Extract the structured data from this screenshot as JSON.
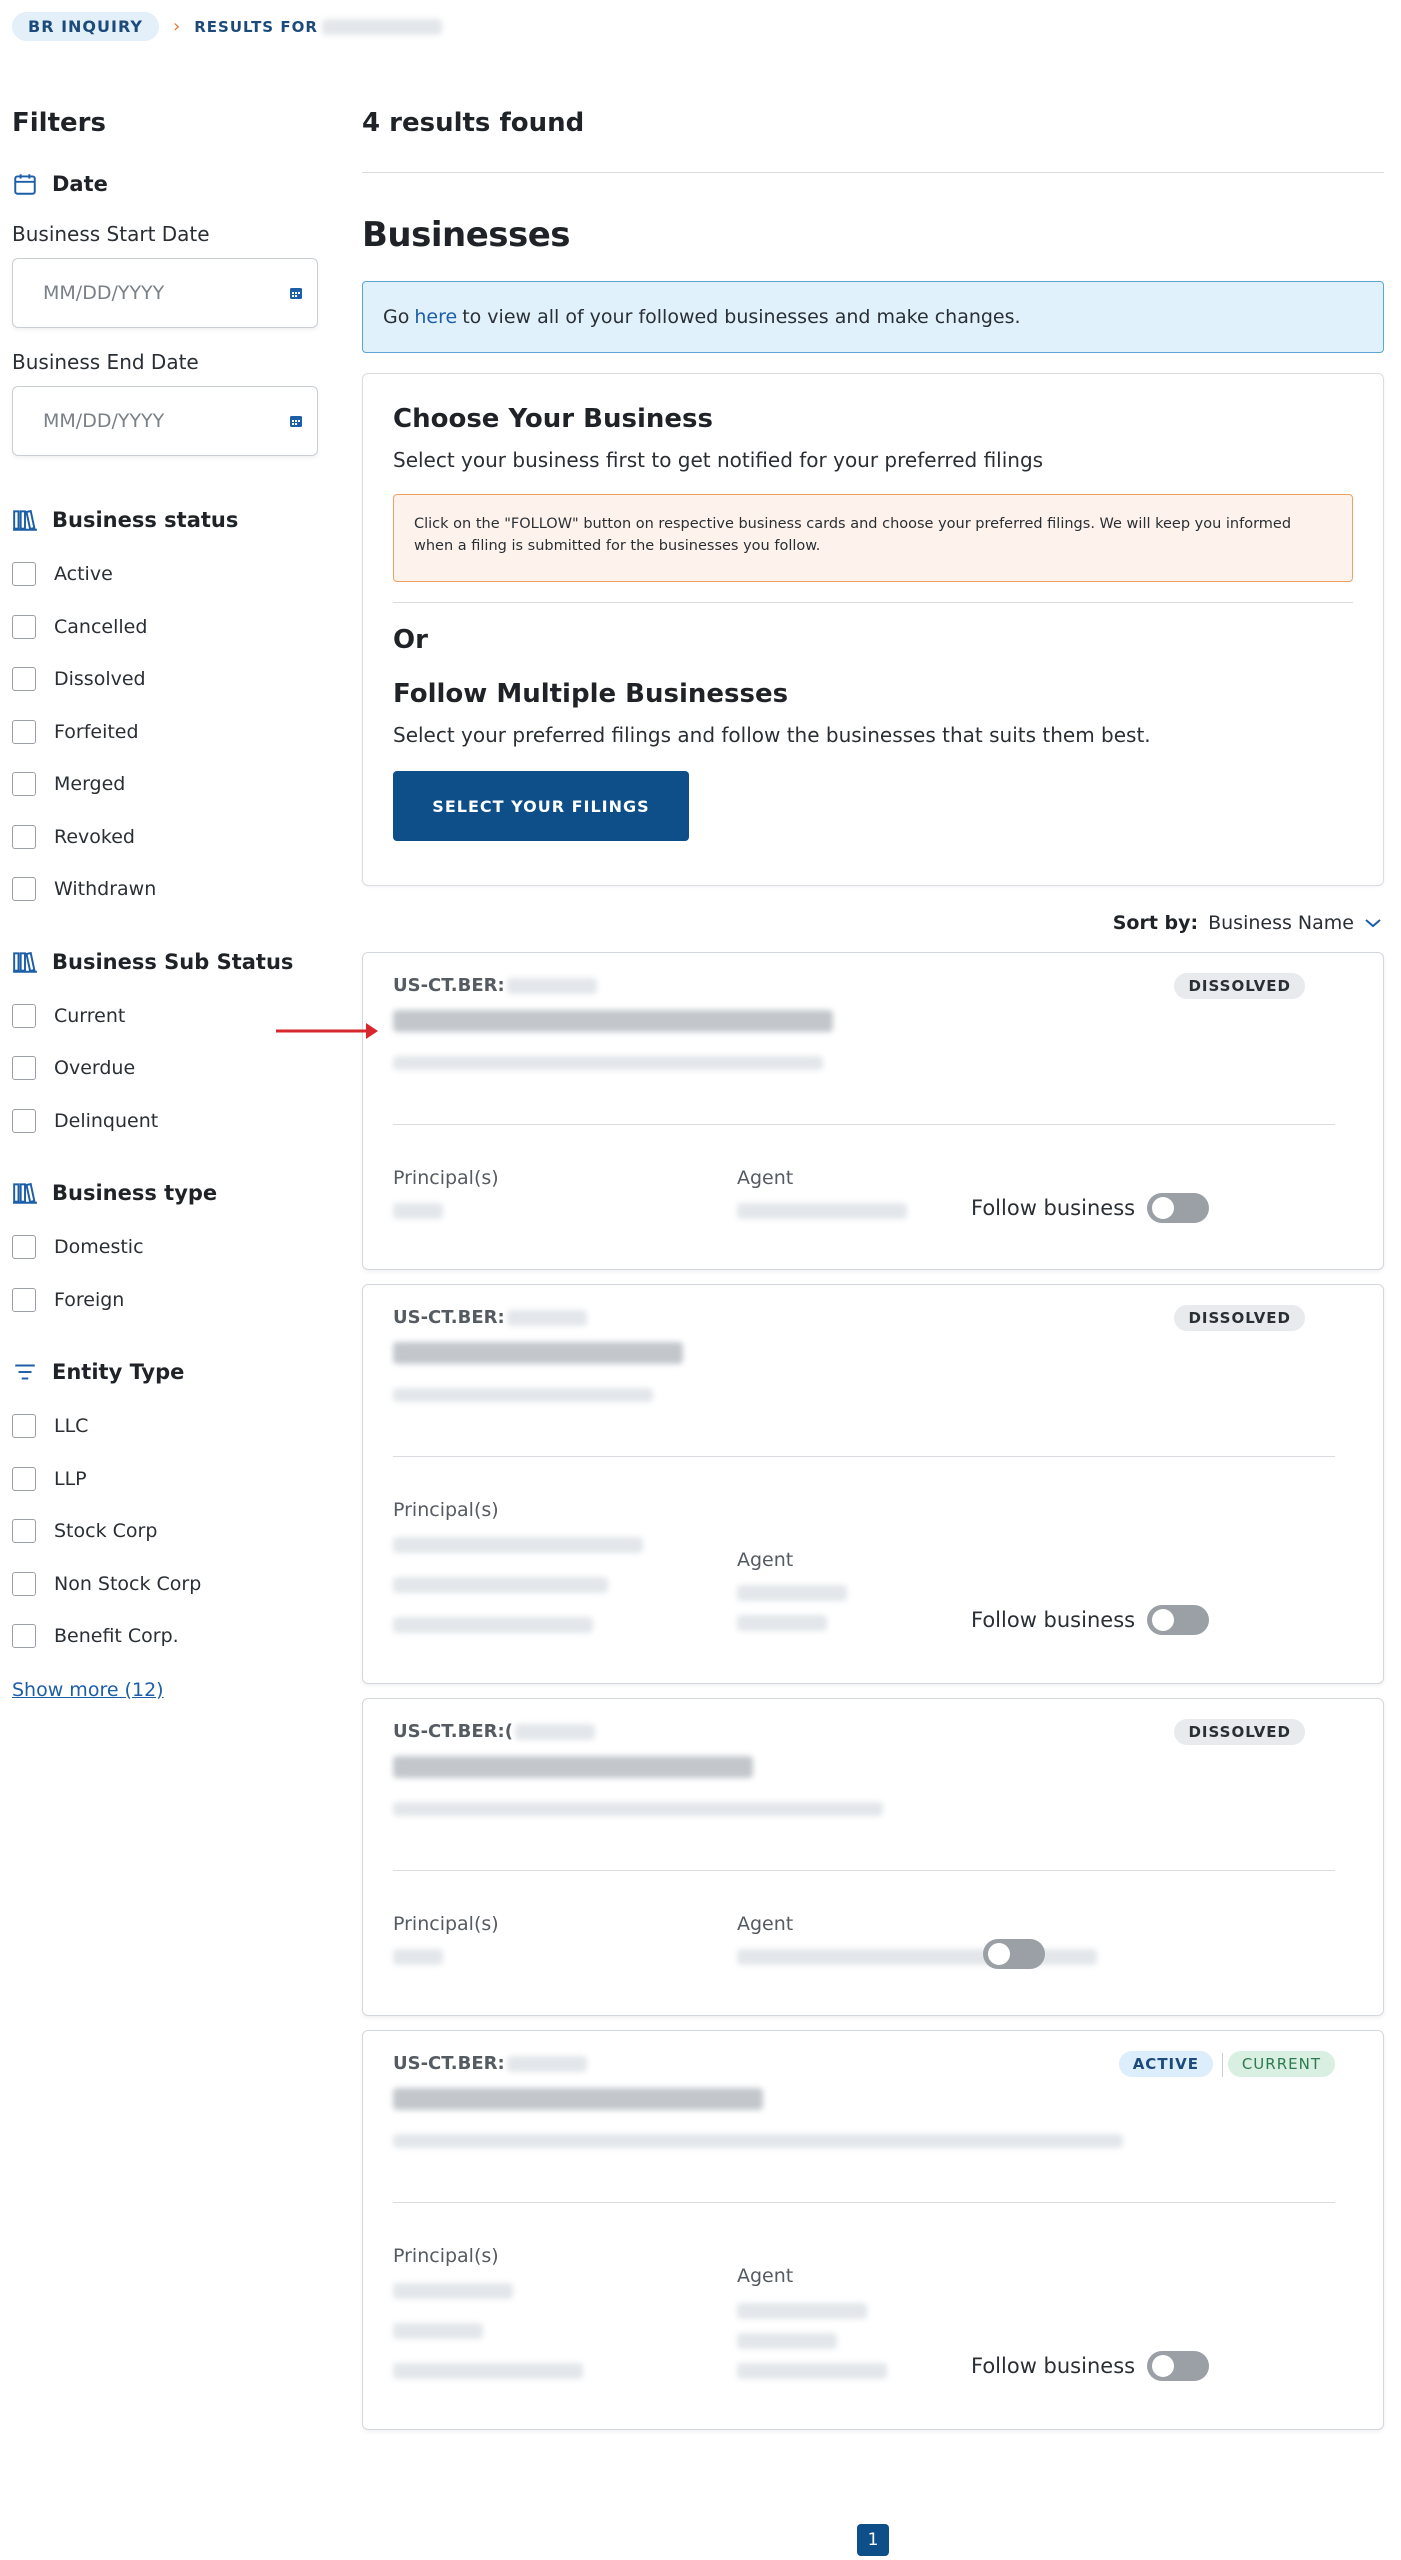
{
  "breadcrumb": {
    "root": "BR INQUIRY",
    "current_prefix": "RESULTS FOR"
  },
  "sidebar": {
    "title": "Filters",
    "date": {
      "title": "Date",
      "start_label": "Business Start Date",
      "start_placeholder": "MM/DD/YYYY",
      "end_label": "Business End Date",
      "end_placeholder": "MM/DD/YYYY"
    },
    "status": {
      "title": "Business status",
      "items": [
        "Active",
        "Cancelled",
        "Dissolved",
        "Forfeited",
        "Merged",
        "Revoked",
        "Withdrawn"
      ]
    },
    "sub_status": {
      "title": "Business Sub Status",
      "items": [
        "Current",
        "Overdue",
        "Delinquent"
      ]
    },
    "type": {
      "title": "Business type",
      "items": [
        "Domestic",
        "Foreign"
      ]
    },
    "entity": {
      "title": "Entity Type",
      "items": [
        "LLC",
        "LLP",
        "Stock Corp",
        "Non Stock Corp",
        "Benefit Corp."
      ]
    },
    "show_more": "Show more (12)"
  },
  "main": {
    "results_count": "4 results found",
    "section_title": "Businesses",
    "banner": {
      "pre": "Go",
      "link": "here",
      "post": "to view all of your followed businesses and make changes."
    },
    "choose": {
      "title": "Choose Your Business",
      "subtitle": "Select your business first to get notified for your preferred filings",
      "notice": "Click on the \"FOLLOW\" button on respective business cards and choose your preferred filings. We will keep you informed when a filing is submitted for the businesses you follow.",
      "or": "Or",
      "multi_title": "Follow Multiple Businesses",
      "multi_subtitle": "Select your preferred filings and follow the businesses that suits them best.",
      "button": "SELECT YOUR FILINGS"
    },
    "sort": {
      "label": "Sort by:",
      "value": "Business Name"
    },
    "cards": [
      {
        "id_prefix": "US-CT.BER:",
        "status": "DISSOLVED",
        "principal_label": "Principal(s)",
        "agent_label": "Agent",
        "follow_label": "Follow business"
      },
      {
        "id_prefix": "US-CT.BER:",
        "status": "DISSOLVED",
        "principal_label": "Principal(s)",
        "agent_label": "Agent",
        "follow_label": "Follow business"
      },
      {
        "id_prefix": "US-CT.BER:(",
        "status": "DISSOLVED",
        "principal_label": "Principal(s)",
        "agent_label": "Agent",
        "follow_label": ""
      },
      {
        "id_prefix": "US-CT.BER:",
        "status": "ACTIVE",
        "sub_status": "CURRENT",
        "principal_label": "Principal(s)",
        "agent_label": "Agent",
        "follow_label": "Follow business"
      }
    ],
    "page": "1"
  },
  "colors": {
    "primary": "#0e4f8a",
    "banner_bg": "#e0f1fb",
    "warning_border": "#f0a062",
    "active_badge": "#dcedfb",
    "current_badge": "#d8efe2"
  }
}
